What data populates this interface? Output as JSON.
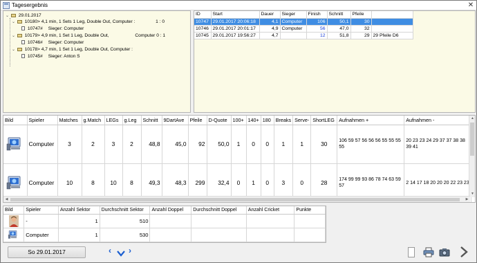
{
  "window": {
    "title": "Tagesergebnis"
  },
  "tree": {
    "root": "29.01.2017",
    "matches": [
      {
        "label": "10180> 4,1 min, 1 Sets 1 Leg, Double Out,  Computer :",
        "score": "1 : 0",
        "child_id": "10747#",
        "child_text": "Sieger: Computer"
      },
      {
        "label": "10179> 4,9 min, 1 Set 1 Leg, Double Out,",
        "score": "Computer   0 : 1",
        "child_id": "10746#",
        "child_text": "Sieger: Computer"
      },
      {
        "label": "10178> 4,7 min, 1 Set 1 Leg, Double Out,  Computer :",
        "score": "",
        "child_id": "10745#",
        "child_text": "Sieger: Anton S"
      }
    ]
  },
  "matches_grid": {
    "headers": [
      "ID",
      "Start",
      "Dauer",
      "Sieger",
      "Finish",
      "Schnitt",
      "Pfeile"
    ],
    "rows": [
      {
        "id": "10747",
        "start": "29.01.2017 20:06:18",
        "dauer": "4,1",
        "sieger": "Computer",
        "finish": "106",
        "schnitt": "50,1",
        "pfeile": "30",
        "extra": "",
        "selected": true
      },
      {
        "id": "10746",
        "start": "29.01.2017 20:01:17",
        "dauer": "4,9",
        "sieger": "Computer",
        "finish": "56",
        "schnitt": "47,0",
        "pfeile": "32",
        "extra": "",
        "selected": false
      },
      {
        "id": "10745",
        "start": "29.01.2017 19:56:27",
        "dauer": "4,7",
        "sieger": "",
        "finish": "12",
        "schnitt": "51,8",
        "pfeile": "29",
        "extra": "29 Pfeile   D6",
        "selected": false
      }
    ]
  },
  "players_grid": {
    "headers": [
      "Bild",
      "Spieler",
      "Matches",
      "g.Match",
      "LEGs",
      "g.Leg",
      "Schnitt",
      "9DartAve",
      "Pfeile",
      "D-Quote",
      "100+",
      "140+",
      "180",
      "Breaks",
      "Serve-",
      "ShortLEG",
      "Aufnahmen +",
      "Aufnahmen -"
    ],
    "rows": [
      {
        "icon": "computer-icon",
        "spieler": "Computer",
        "matches": "3",
        "g_match": "2",
        "legs": "3",
        "g_leg": "2",
        "schnitt": "48,8",
        "ninedart": "45,0",
        "pfeile": "92",
        "dquote": "50,0",
        "h100": "1",
        "h140": "0",
        "h180": "0",
        "breaks": "1",
        "serve": "1",
        "shortleg": "30",
        "auf_plus": "106  59  57  56  56  56  55  55  55  55",
        "auf_minus": "20  23  23  24  29  37  37  38  38  39  41"
      },
      {
        "icon": "computer-icon",
        "spieler": "Computer",
        "matches": "10",
        "g_match": "8",
        "legs": "10",
        "g_leg": "8",
        "schnitt": "49,3",
        "ninedart": "48,3",
        "pfeile": "299",
        "dquote": "32,4",
        "h100": "0",
        "h140": "1",
        "h180": "0",
        "breaks": "3",
        "serve": "0",
        "shortleg": "28",
        "auf_plus": "174  99  99  93  86  78  74  63  59  57",
        "auf_minus": "2  14  17  18  20  20  20  22  23  23"
      }
    ]
  },
  "stats_grid": {
    "headers": [
      "Bild",
      "Spieler",
      "Anzahl Sektor",
      "Durchschnitt Sektor",
      "Anzahl Doppel",
      "Durchschnitt Doppel",
      "Anzahl Cricket",
      "Punkte"
    ],
    "rows": [
      {
        "icon": "avatar-icon",
        "spieler": "-",
        "anzahl_sektor": "1",
        "durchschnitt_sektor": "510"
      },
      {
        "icon": "computer-icon",
        "spieler": "Computer",
        "anzahl_sektor": "1",
        "durchschnitt_sektor": "530"
      }
    ]
  },
  "footer": {
    "date_button": "So 29.01.2017"
  },
  "colors": {
    "selection": "#3f8de3",
    "finish_blue": "#1a3fd9",
    "panel_bg": "#fbfae6",
    "nav_blue": "#1c5fd0"
  }
}
